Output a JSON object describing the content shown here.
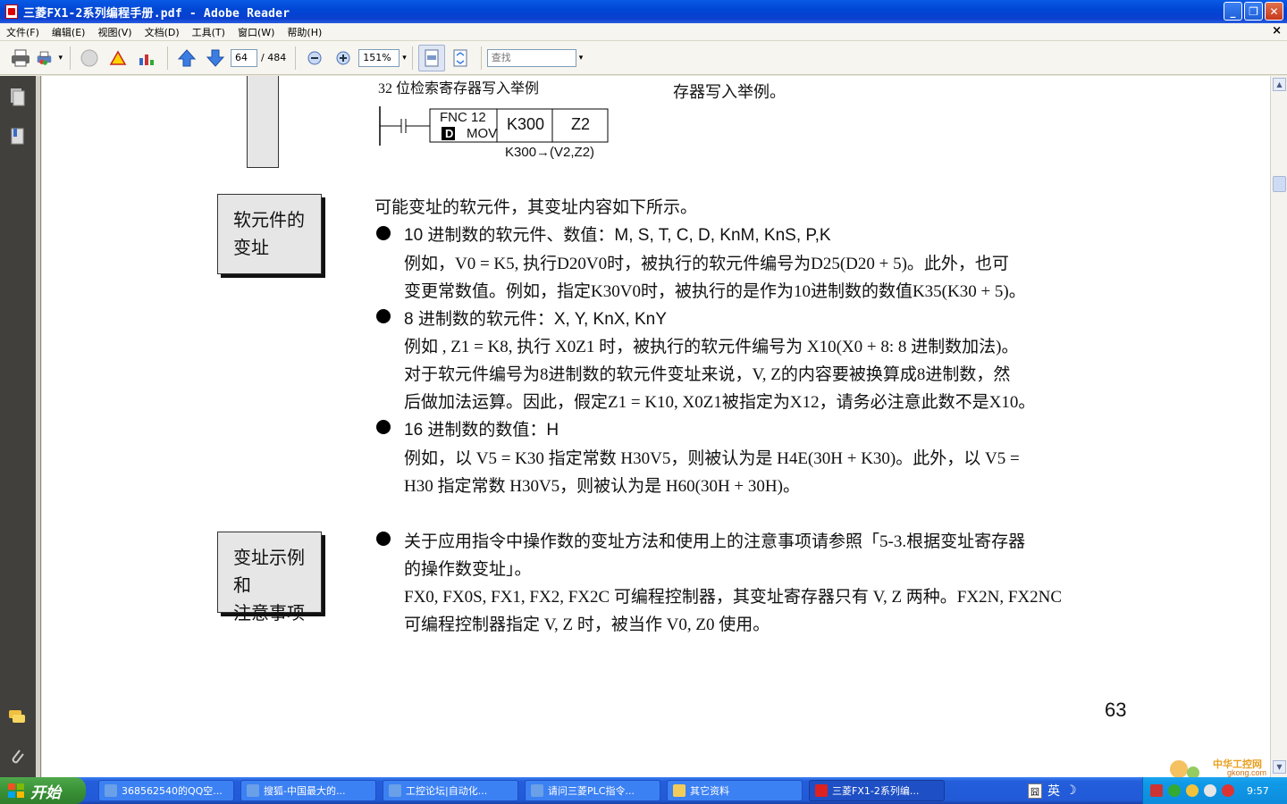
{
  "window": {
    "title": "三菱FX1-2系列编程手册.pdf - Adobe Reader",
    "min_label": "_",
    "max_label": "❐",
    "close_label": "✕"
  },
  "menu": {
    "items": [
      "文件(F)",
      "编辑(E)",
      "视图(V)",
      "文档(D)",
      "工具(T)",
      "窗口(W)",
      "帮助(H)"
    ],
    "doc_close": "×"
  },
  "toolbar": {
    "page_current": "64",
    "page_total": "/ 484",
    "zoom": "151%",
    "search_placeholder": "查找"
  },
  "page": {
    "example_caption": "32 位检索寄存器写入举例",
    "example_caption_right": "存器写入举例。",
    "ladder": {
      "fnc": "FNC 12",
      "d": "D",
      "mov": "MOV",
      "src": "K300",
      "dst": "Z2",
      "note": "K300→(V2,Z2)"
    },
    "box1": {
      "line1": "软元件的",
      "line2": "变址"
    },
    "box2": {
      "line1": "变址示例和",
      "line2": "注意事项"
    },
    "intro": "可能变址的软元件，其变址内容如下所示。",
    "b1_head": "10 进制数的软元件、数值：",
    "b1_vals": "M, S, T, C, D, KnM, KnS, P,K",
    "b1_l1": "例如，V0 = K5, 执行D20V0时，被执行的软元件编号为D25(D20 + 5)。此外，也可",
    "b1_l2": "变更常数值。例如，指定K30V0时，被执行的是作为10进制数的数值K35(K30 + 5)。",
    "b2_head": "8 进制数的软元件：",
    "b2_vals": "X, Y, KnX, KnY",
    "b2_l1": "例如 , Z1 = K8, 执行 X0Z1 时，被执行的软元件编号为 X10(X0 + 8: 8 进制数加法)。",
    "b2_l2": "对于软元件编号为8进制数的软元件变址来说，V, Z的内容要被换算成8进制数，然",
    "b2_l3": "后做加法运算。因此，假定Z1 = K10, X0Z1被指定为X12，请务必注意此数不是X10。",
    "b3_head": "16 进制数的数值：",
    "b3_vals": "H",
    "b3_l1": "例如，以 V5 = K30 指定常数 H30V5，则被认为是 H4E(30H + K30)。此外，以 V5 =",
    "b3_l2": "H30 指定常数 H30V5，则被认为是 H60(30H + 30H)。",
    "b4_l1": "关于应用指令中操作数的变址方法和使用上的注意事项请参照「5-3.根据变址寄存器",
    "b4_l2": "的操作数变址」。",
    "b4_l3": "FX0, FX0S, FX1, FX2, FX2C 可编程控制器，其变址寄存器只有 V, Z 两种。FX2N, FX2NC",
    "b4_l4": "可编程控制器指定 V, Z 时，被当作 V0, Z0 使用。",
    "page_number": "63",
    "watermark_line1": "中华工控网",
    "watermark_line2": "gkong.com"
  },
  "taskbar": {
    "start_label": "开始",
    "tasks": [
      {
        "label": "368562540的QQ空...",
        "color": "#6aa0e8"
      },
      {
        "label": "搜狐-中国最大的...",
        "color": "#6aa0e8"
      },
      {
        "label": "工控论坛|自动化...",
        "color": "#6aa0e8"
      },
      {
        "label": "请问三菱PLC指令...",
        "color": "#6aa0e8"
      },
      {
        "label": "其它资料",
        "color": "#f2cc5a"
      },
      {
        "label": "三菱FX1-2系列编...",
        "color": "#d22"
      }
    ],
    "ime_label": "英",
    "clock": "9:57"
  }
}
